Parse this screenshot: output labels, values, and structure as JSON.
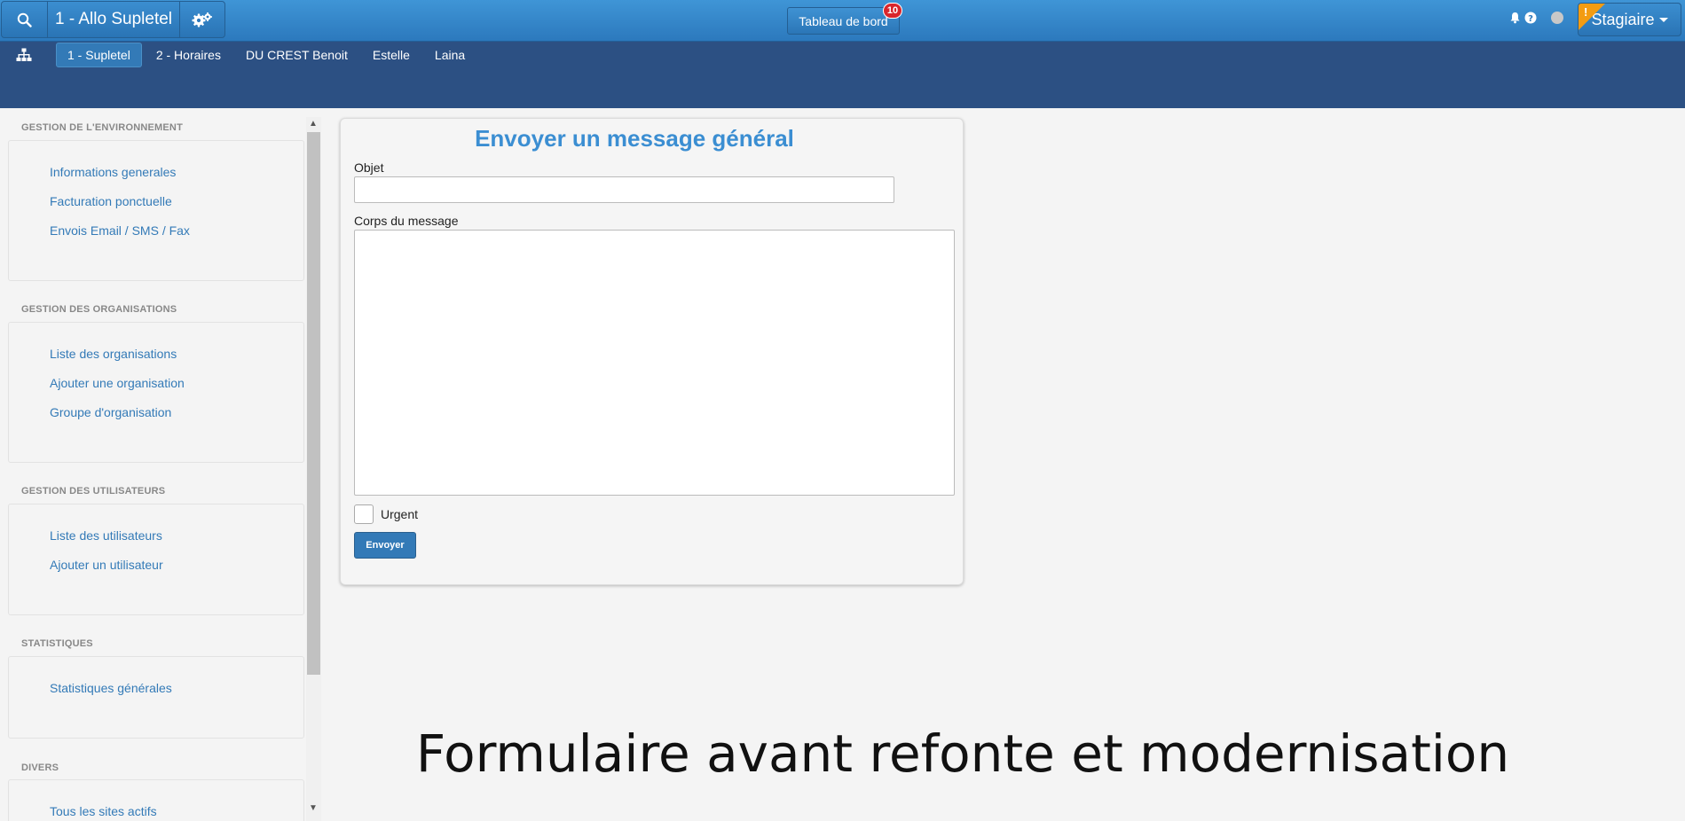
{
  "topbar": {
    "app_label": "1 - Allo Supletel",
    "dashboard_label": "Tableau de bord",
    "dashboard_badge": "10",
    "user_label": "Stagiaire",
    "warning_mark": "!"
  },
  "subnav": {
    "tabs": [
      {
        "label": "1 - Supletel",
        "active": true
      },
      {
        "label": "2 - Horaires",
        "active": false
      },
      {
        "label": "DU CREST Benoit",
        "active": false
      },
      {
        "label": "Estelle",
        "active": false
      },
      {
        "label": "Laina",
        "active": false
      }
    ]
  },
  "sidebar": {
    "sections": [
      {
        "title": "GESTION DE L'ENVIRONNEMENT",
        "items": [
          "Informations generales",
          "Facturation ponctuelle",
          "Envois Email / SMS / Fax"
        ]
      },
      {
        "title": "GESTION DES ORGANISATIONS",
        "items": [
          "Liste des organisations",
          "Ajouter une organisation",
          "Groupe d'organisation"
        ]
      },
      {
        "title": "GESTION DES UTILISATEURS",
        "items": [
          "Liste des utilisateurs",
          "Ajouter un utilisateur"
        ]
      },
      {
        "title": "STATISTIQUES",
        "items": [
          "Statistiques générales"
        ]
      },
      {
        "title": "DIVERS",
        "items": [
          "Tous les sites actifs"
        ]
      }
    ]
  },
  "form": {
    "title": "Envoyer un message général",
    "objet_label": "Objet",
    "objet_value": "",
    "body_label": "Corps du message",
    "body_value": "",
    "urgent_label": "Urgent",
    "submit_label": "Envoyer"
  },
  "caption": "Formulaire avant refonte et modernisation",
  "colors": {
    "topbar": "#2c79bd",
    "subnav": "#2c5083",
    "accent": "#337ab7",
    "title": "#3b8ed2",
    "badge": "#d9262c",
    "warning": "#f39c12"
  }
}
